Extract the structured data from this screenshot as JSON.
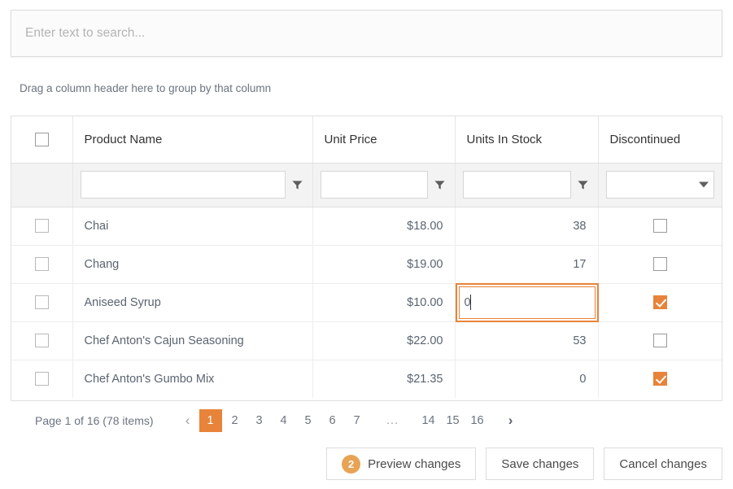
{
  "search": {
    "placeholder": "Enter text to search...",
    "value": ""
  },
  "group_hint": "Drag a column header here to group by that column",
  "grid": {
    "columns": [
      {
        "key": "select",
        "label": ""
      },
      {
        "key": "product_name",
        "label": "Product Name"
      },
      {
        "key": "unit_price",
        "label": "Unit Price"
      },
      {
        "key": "units_in_stock",
        "label": "Units In Stock"
      },
      {
        "key": "discontinued",
        "label": "Discontinued"
      }
    ],
    "filters": {
      "product_name": "",
      "unit_price": "",
      "units_in_stock": "",
      "discontinued": ""
    },
    "filter_icon": "funnel-icon",
    "dropdown_icon": "chevron-down-icon",
    "rows": [
      {
        "selected": false,
        "product_name": "Chai",
        "unit_price": "$18.00",
        "units_in_stock": "38",
        "units_in_stock_modified": true,
        "discontinued": false,
        "discontinued_modified": false,
        "editing": false
      },
      {
        "selected": false,
        "product_name": "Chang",
        "unit_price": "$19.00",
        "units_in_stock": "17",
        "units_in_stock_modified": false,
        "discontinued": false,
        "discontinued_modified": false,
        "editing": false
      },
      {
        "selected": false,
        "product_name": "Aniseed Syrup",
        "unit_price": "$10.00",
        "units_in_stock": "0",
        "units_in_stock_modified": false,
        "discontinued": true,
        "discontinued_modified": true,
        "editing": true
      },
      {
        "selected": false,
        "product_name": "Chef Anton's Cajun Seasoning",
        "unit_price": "$22.00",
        "units_in_stock": "53",
        "units_in_stock_modified": false,
        "discontinued": false,
        "discontinued_modified": false,
        "editing": false
      },
      {
        "selected": false,
        "product_name": "Chef Anton's Gumbo Mix",
        "unit_price": "$21.35",
        "units_in_stock": "0",
        "units_in_stock_modified": false,
        "discontinued": true,
        "discontinued_modified": false,
        "editing": false
      }
    ],
    "header_select_all": false
  },
  "pager": {
    "info": "Page 1 of 16 (78 items)",
    "prev_icon": "‹",
    "next_icon": "›",
    "pages": [
      "1",
      "2",
      "3",
      "4",
      "5",
      "6",
      "7"
    ],
    "ellipsis": "...",
    "tail_pages": [
      "14",
      "15",
      "16"
    ],
    "current": "1"
  },
  "buttons": {
    "preview": {
      "label": "Preview changes",
      "badge": "2"
    },
    "save": {
      "label": "Save changes"
    },
    "cancel": {
      "label": "Cancel changes"
    }
  },
  "colors": {
    "accent": "#e8833a",
    "modified_bg": "#d9f0c7",
    "text": "#5a6470",
    "border": "#e0e0e0"
  }
}
